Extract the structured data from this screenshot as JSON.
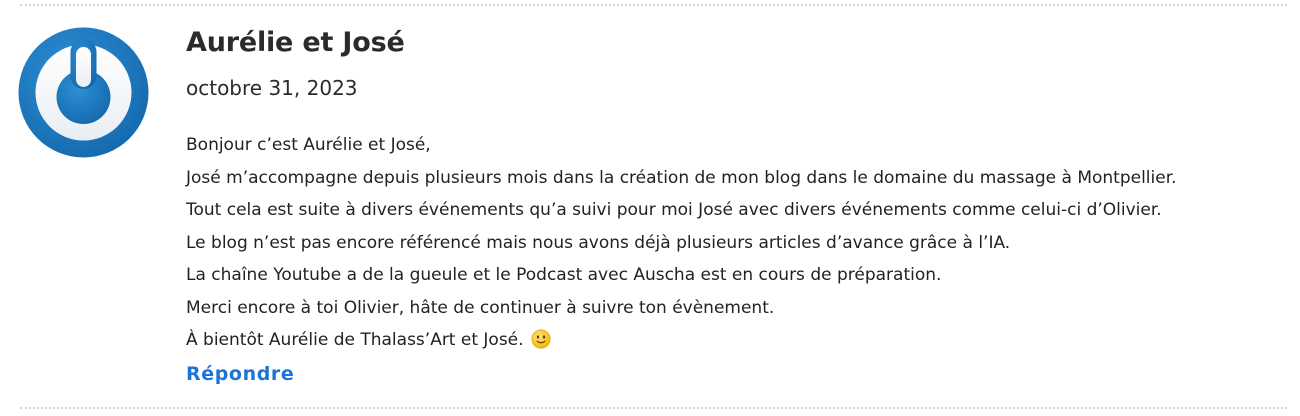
{
  "comment": {
    "author": "Aurélie et José",
    "date": "octobre 31, 2023",
    "lines": [
      "Bonjour c’est Aurélie et José,",
      "José m’accompagne depuis plusieurs mois dans la création de mon blog dans le domaine du massage à Montpellier.",
      "Tout cela est suite à divers événements qu’a suivi pour moi José avec divers événements comme celui-ci d’Olivier.",
      "Le blog n’est pas encore référencé mais nous avons déjà plusieurs articles d’avance grâce à l’IA.",
      "La chaîne Youtube a de la gueule et le Podcast avec Auscha est en cours de préparation.",
      "Merci encore à toi Olivier, hâte de continuer à suivre ton évènement.",
      "À bientôt Aurélie de Thalass’Art et José."
    ],
    "emoji": "slightly-smiling-face-icon",
    "reply_label": "Répondre"
  },
  "avatar": {
    "icon": "power-button-avatar-icon",
    "colors": {
      "ring": "#1a79c0",
      "inner": "#ffffff"
    }
  },
  "colors": {
    "link": "#1b74d8",
    "text": "#222222",
    "divider": "#d6d6d6"
  }
}
